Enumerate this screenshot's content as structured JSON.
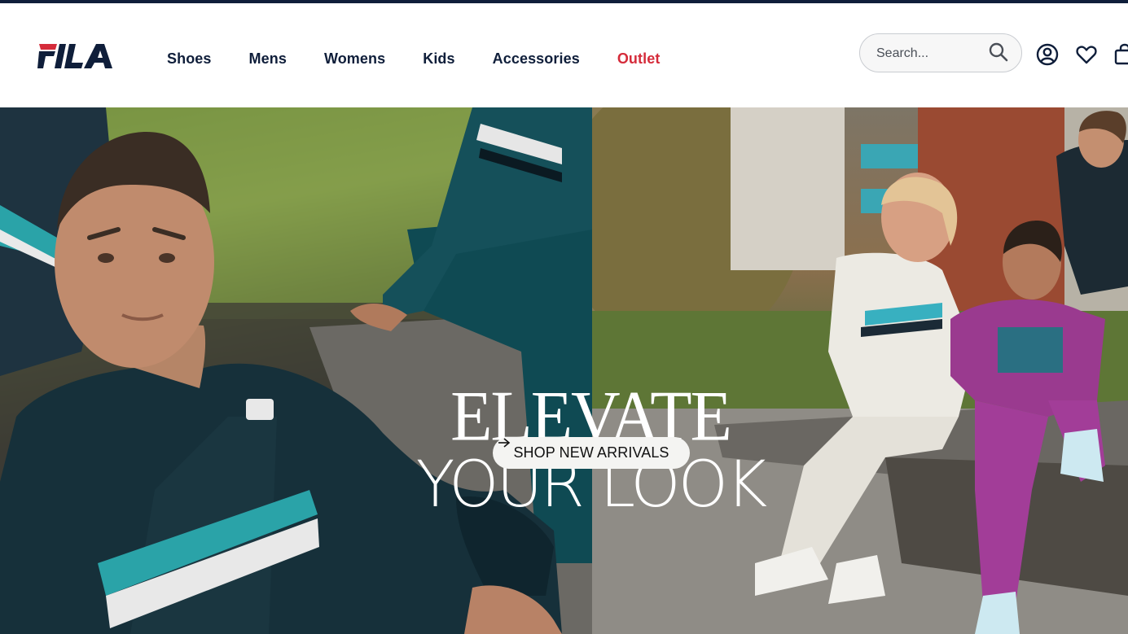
{
  "brand": {
    "logo_text": "FILA",
    "primary_color": "#0f1e3a",
    "accent_color": "#d52b3a"
  },
  "nav": {
    "items": [
      {
        "label": "Shoes"
      },
      {
        "label": "Mens"
      },
      {
        "label": "Womens"
      },
      {
        "label": "Kids"
      },
      {
        "label": "Accessories"
      },
      {
        "label": "Outlet",
        "color": "#d52b3a"
      }
    ]
  },
  "search": {
    "placeholder": "Search...",
    "value": "",
    "icon": "search-icon"
  },
  "header_icons": [
    {
      "name": "account-icon"
    },
    {
      "name": "wishlist-heart-icon"
    },
    {
      "name": "cart-bag-icon"
    }
  ],
  "hero": {
    "headline_line1": "ELEVATE",
    "headline_line2": "YOUR LOOK",
    "cta_label": "SHOP NEW ARRIVALS",
    "cta_icon": "arrow-right-icon"
  }
}
